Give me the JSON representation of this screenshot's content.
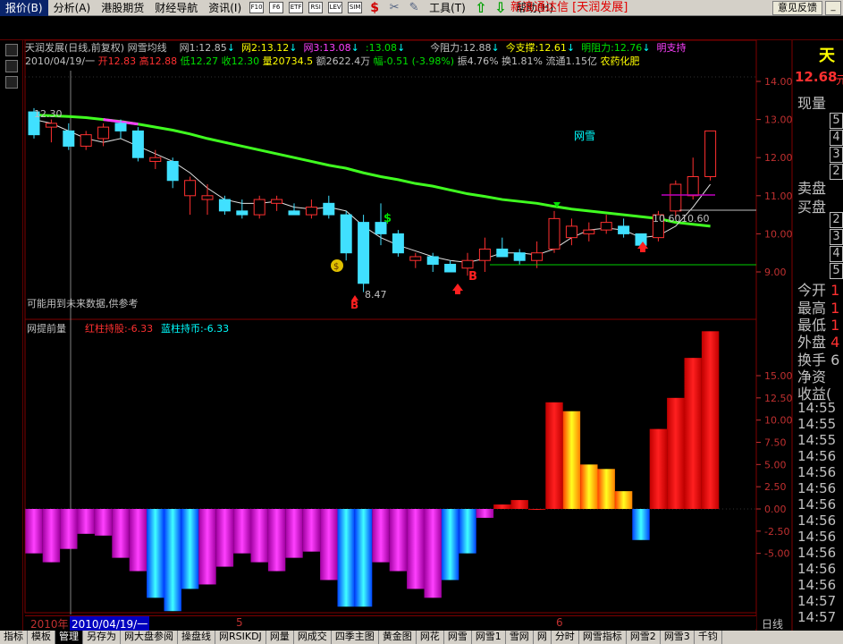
{
  "menu": {
    "items": [
      "报价(B)",
      "分析(A)",
      "港股期货",
      "财经导航",
      "资讯(I)",
      "工具(T)",
      "帮助(H)"
    ],
    "toolbar_icons": [
      "F10-icon",
      "F6-icon",
      "ETF-icon",
      "RSI-icon",
      "LEV-icon",
      "SIM-icon",
      "dollar-icon",
      "tools-icon",
      "pen-icon",
      "up-arrow-icon",
      "down-arrow-icon"
    ],
    "toolbar_labels": [
      "F10",
      "F6",
      "ETF",
      "RSI",
      "LEV",
      "SIM"
    ]
  },
  "app_title": "新浪通达信 [天润发展]",
  "feedback_label": "意见反馈",
  "minimize_label": "_",
  "header1": {
    "stock": "天润发展(日线,前复权)",
    "indicator": "网雪均线",
    "net1": "网1:12.85",
    "net2": "网2:13.12",
    "net3": "网3:13.08",
    "net4": ":13.08",
    "resist": "今阻力:12.88",
    "support": "今支撑:12.61",
    "next_resist": "明阻力:12.76",
    "next_support": "明支持"
  },
  "header2": {
    "date": "2010/04/19/一",
    "open": "开12.83",
    "high": "高12.88",
    "low": "低12.27",
    "close": "收12.30",
    "volume": "量20734.5",
    "amount": "额2622.4万",
    "change": "幅-0.51 (-3.98%)",
    "amplitude": "振4.76%",
    "turnover": "换1.81%",
    "float": "流通1.15亿",
    "sector": "农药化肥"
  },
  "main_chart": {
    "price_axis": [
      "14.00",
      "13.00",
      "12.00",
      "11.00",
      "10.00",
      "9.00"
    ],
    "label_start": "12.30",
    "label_low": "8.47",
    "label_last": "10.60",
    "label_last2": "10.60",
    "label_wangxue": "网雪",
    "note": "可能用到未来数据,供参考",
    "marker_dollar": "$",
    "marker_b1": "B",
    "marker_b2": "B",
    "marker_bag": "$"
  },
  "sub_chart": {
    "title": "网提前量",
    "red_label": "红柱持股:-6.33",
    "blue_label": "蓝柱持币:-6.33",
    "axis": [
      "15.00",
      "12.50",
      "10.00",
      "7.50",
      "5.00",
      "2.50",
      "0.00",
      "-2.50",
      "-5.00"
    ]
  },
  "chart_data": [
    {
      "type": "candlestick",
      "title": "天润发展(日线,前复权)",
      "ylim": [
        8.3,
        14.2
      ],
      "candles": [
        {
          "o": 13.2,
          "h": 13.3,
          "l": 12.5,
          "c": 12.6
        },
        {
          "o": 12.8,
          "h": 13.0,
          "l": 12.4,
          "c": 12.9
        },
        {
          "o": 12.7,
          "h": 12.9,
          "l": 12.2,
          "c": 12.3
        },
        {
          "o": 12.3,
          "h": 12.7,
          "l": 12.2,
          "c": 12.6
        },
        {
          "o": 12.5,
          "h": 12.9,
          "l": 12.3,
          "c": 12.8
        },
        {
          "o": 12.9,
          "h": 13.0,
          "l": 12.5,
          "c": 12.7
        },
        {
          "o": 12.7,
          "h": 12.8,
          "l": 11.9,
          "c": 12.0
        },
        {
          "o": 11.9,
          "h": 12.2,
          "l": 11.7,
          "c": 12.0
        },
        {
          "o": 11.9,
          "h": 12.0,
          "l": 11.2,
          "c": 11.4
        },
        {
          "o": 11.0,
          "h": 11.5,
          "l": 10.5,
          "c": 11.4
        },
        {
          "o": 10.9,
          "h": 11.3,
          "l": 10.5,
          "c": 11.0
        },
        {
          "o": 10.9,
          "h": 11.0,
          "l": 10.5,
          "c": 10.6
        },
        {
          "o": 10.6,
          "h": 10.9,
          "l": 10.4,
          "c": 10.5
        },
        {
          "o": 10.5,
          "h": 11.0,
          "l": 10.4,
          "c": 10.9
        },
        {
          "o": 10.8,
          "h": 11.0,
          "l": 10.6,
          "c": 10.9
        },
        {
          "o": 10.6,
          "h": 10.8,
          "l": 10.5,
          "c": 10.5
        },
        {
          "o": 10.5,
          "h": 10.9,
          "l": 10.4,
          "c": 10.7
        },
        {
          "o": 10.8,
          "h": 11.0,
          "l": 10.4,
          "c": 10.5
        },
        {
          "o": 10.5,
          "h": 10.6,
          "l": 9.3,
          "c": 9.5
        },
        {
          "o": 10.3,
          "h": 10.5,
          "l": 8.47,
          "c": 8.7
        },
        {
          "o": 10.3,
          "h": 10.8,
          "l": 9.7,
          "c": 10.0
        },
        {
          "o": 10.0,
          "h": 10.1,
          "l": 9.4,
          "c": 9.5
        },
        {
          "o": 9.3,
          "h": 9.5,
          "l": 9.1,
          "c": 9.4
        },
        {
          "o": 9.4,
          "h": 9.5,
          "l": 9.0,
          "c": 9.2
        },
        {
          "o": 9.2,
          "h": 9.3,
          "l": 9.0,
          "c": 9.0
        },
        {
          "o": 9.1,
          "h": 9.5,
          "l": 8.9,
          "c": 9.3
        },
        {
          "o": 9.3,
          "h": 9.9,
          "l": 9.0,
          "c": 9.6
        },
        {
          "o": 9.6,
          "h": 9.9,
          "l": 9.4,
          "c": 9.4
        },
        {
          "o": 9.5,
          "h": 9.6,
          "l": 9.2,
          "c": 9.3
        },
        {
          "o": 9.3,
          "h": 9.8,
          "l": 9.1,
          "c": 9.5
        },
        {
          "o": 9.6,
          "h": 10.6,
          "l": 9.5,
          "c": 10.4
        },
        {
          "o": 9.9,
          "h": 10.4,
          "l": 9.7,
          "c": 10.2
        },
        {
          "o": 10.0,
          "h": 10.3,
          "l": 9.8,
          "c": 10.1
        },
        {
          "o": 10.1,
          "h": 10.5,
          "l": 10.0,
          "c": 10.3
        },
        {
          "o": 10.2,
          "h": 10.4,
          "l": 9.9,
          "c": 10.0
        },
        {
          "o": 10.0,
          "h": 10.0,
          "l": 9.6,
          "c": 9.7
        },
        {
          "o": 9.9,
          "h": 10.6,
          "l": 9.8,
          "c": 10.5
        },
        {
          "o": 10.6,
          "h": 11.4,
          "l": 10.4,
          "c": 11.3
        },
        {
          "o": 11.0,
          "h": 12.0,
          "l": 10.9,
          "c": 11.5
        },
        {
          "o": 11.5,
          "h": 12.7,
          "l": 11.4,
          "c": 12.7
        }
      ],
      "series": [
        {
          "name": "网雪均线",
          "values": [
            13.12,
            13.1,
            13.08,
            13.05,
            13.0,
            12.95,
            12.88,
            12.8,
            12.72,
            12.62,
            12.5,
            12.4,
            12.3,
            12.2,
            12.1,
            12.0,
            11.9,
            11.8,
            11.72,
            11.6,
            11.5,
            11.42,
            11.32,
            11.25,
            11.15,
            11.05,
            10.98,
            10.9,
            10.85,
            10.8,
            10.72,
            10.65,
            10.6,
            10.55,
            10.5,
            10.45,
            10.4,
            10.3,
            10.25,
            10.2
          ]
        },
        {
          "name": "",
          "values": [
            13.0,
            12.9,
            12.7,
            12.5,
            12.4,
            12.5,
            12.3,
            12.1,
            11.9,
            11.6,
            11.2,
            10.9,
            10.8,
            10.8,
            10.85,
            10.7,
            10.65,
            10.7,
            10.6,
            10.2,
            9.9,
            9.7,
            9.55,
            9.4,
            9.3,
            9.25,
            9.35,
            9.5,
            9.5,
            9.45,
            9.6,
            9.9,
            10.1,
            10.15,
            10.1,
            9.9,
            9.95,
            10.2,
            10.7,
            11.3
          ]
        }
      ]
    },
    {
      "type": "bar",
      "title": "网提前量",
      "ylim": [
        -12.5,
        20.0
      ],
      "series": [
        {
          "name": "红柱持股",
          "values": [
            -5.0,
            -6.0,
            -4.5,
            -2.8,
            -3.0,
            -5.5,
            -7.0,
            -10.0,
            -11.5,
            -9.0,
            -8.5,
            -6.5,
            -5.0,
            -6.0,
            -7.0,
            -5.5,
            -4.8,
            -8.0,
            -11.0,
            -11.0,
            -6.0,
            -7.0,
            -9.0,
            -10.0,
            -8.0,
            -5.0,
            -1.0,
            0.5,
            1.0,
            0.0,
            12.0,
            11.0,
            5.0,
            4.5,
            2.0,
            -3.5,
            9.0,
            12.5,
            17.0,
            20.0
          ]
        }
      ]
    }
  ]
}
